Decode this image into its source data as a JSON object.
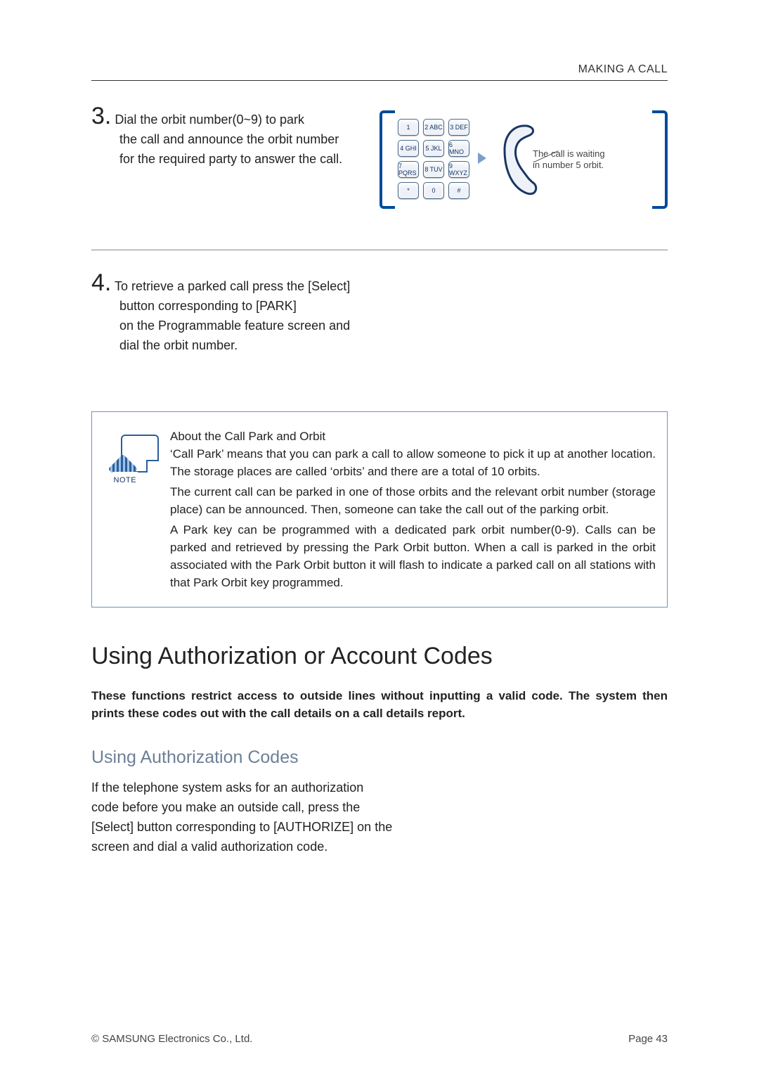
{
  "running_header": "MAKING A CALL",
  "steps": {
    "s3": {
      "num": "3.",
      "first_line": "Dial the orbit number(0~9) to park",
      "line2": "the call and announce the orbit number",
      "line3": "for the required party to answer the call."
    },
    "s4": {
      "num": "4.",
      "first_line": "To retrieve a parked call press the [Select]",
      "line2": "button corresponding to [PARK]",
      "line3": "on the Programmable feature screen and",
      "line4": "dial the orbit number."
    }
  },
  "keypad": [
    "1",
    "2 ABC",
    "3 DEF",
    "4 GHI",
    "5 JKL",
    "6 MNO",
    "7 PQRS",
    "8 TUV",
    "9 WXYZ",
    "*",
    "0",
    "#"
  ],
  "callout": {
    "line1": "The call is waiting",
    "line2": "in number 5 orbit."
  },
  "note": {
    "label": "NOTE",
    "title": "About the Call Park and Orbit",
    "p1": "‘Call Park’ means that you can park a call to allow someone to pick it up at another location. The storage places are called ‘orbits’ and there are a total of 10 orbits.",
    "p2": "The current call can be parked in one of those orbits and the relevant orbit number (storage place) can be announced. Then, someone can take the call out of the parking orbit.",
    "p3": "A Park key can be programmed with a dedicated park orbit number(0-9). Calls can be parked and retrieved by pressing the Park Orbit button. When a call is parked in the orbit associated with the Park Orbit button it will flash to indicate a parked call on all stations with that Park Orbit key programmed."
  },
  "section_heading": "Using Authorization or Account Codes",
  "intro": "These functions restrict access to outside lines without inputting a valid code. The system then prints these codes out with the call details on a call details report.",
  "subheading": "Using Authorization Codes",
  "sub_para": "If the telephone system asks for an authorization code before you make an outside call, press the [Select] button corresponding to [AUTHORIZE] on the screen and dial a valid authorization code.",
  "footer": {
    "left": "© SAMSUNG Electronics Co., Ltd.",
    "right": "Page 43"
  }
}
